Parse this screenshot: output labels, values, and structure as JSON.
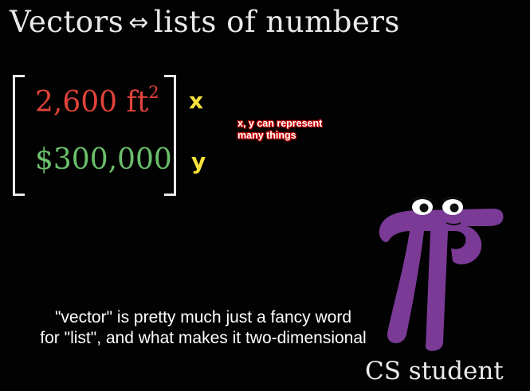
{
  "title": {
    "left": "Vectors",
    "arrow": "⇔",
    "right": "lists of numbers"
  },
  "vector": {
    "top_value": "2,600 ft",
    "top_exponent": "2",
    "bottom_value": "$300,000",
    "top_color": "#e0433a",
    "bottom_color": "#6bbf6b"
  },
  "labels": {
    "x": "x",
    "y": "y",
    "color": "#f7e23a"
  },
  "annotation": {
    "line1": "x, y can represent",
    "line2": "many things",
    "color": "#d10000"
  },
  "subtitle": {
    "line1": "\"vector\" is pretty much just a fancy word",
    "line2": "for \"list\", and what makes it two-dimensional"
  },
  "character": {
    "name": "CS student",
    "icon": "pi-creature-icon",
    "color": "#7a3a96"
  }
}
